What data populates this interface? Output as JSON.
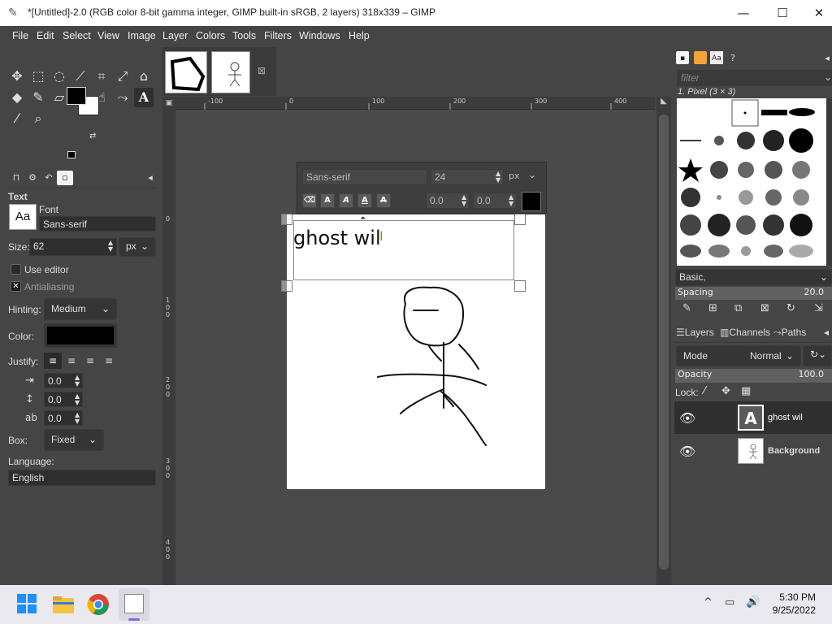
{
  "window": {
    "title": "*[Untitled]-2.0 (RGB color 8-bit gamma integer, GIMP built-in sRGB, 2 layers) 318x339 – GIMP",
    "minimize": "—",
    "maximize": "☐",
    "close": "✕"
  },
  "menu": [
    "File",
    "Edit",
    "Select",
    "View",
    "Image",
    "Layer",
    "Colors",
    "Tools",
    "Filters",
    "Windows",
    "Help"
  ],
  "toolbox": {
    "tools": [
      "move-icon",
      "rect-select-icon",
      "lasso-icon",
      "fuzzy-select-icon",
      "crop-icon",
      "transform-icon",
      "warp-icon",
      "bucket-fill-icon",
      "paintbrush-icon",
      "eraser-icon",
      "clone-icon",
      "smudge-icon",
      "paths-icon",
      "text-icon",
      "color-picker-icon",
      "zoom-icon"
    ]
  },
  "tool_options": {
    "section_title": "Text",
    "font_label": "Font",
    "font_preview": "Aa",
    "font_value": "Sans-serif",
    "size_label": "Size:",
    "size_value": "62",
    "size_unit": "px",
    "use_editor": "Use editor",
    "antialiasing": "Antialiasing",
    "hinting_label": "Hinting:",
    "hinting_value": "Medium",
    "color_label": "Color:",
    "justify_label": "Justify:",
    "indent_value": "0.0",
    "line_spacing_value": "0.0",
    "letter_spacing_value": "0.0",
    "box_label": "Box:",
    "box_value": "Fixed",
    "language_label": "Language:",
    "language_value": "English"
  },
  "rulers": {
    "h_ticks": [
      "-100",
      "0",
      "100",
      "200",
      "300",
      "400"
    ],
    "v_ticks": [
      "100",
      "200",
      "300",
      "400"
    ],
    "v_zero": "0"
  },
  "text_style_editor": {
    "font": "Sans-serif",
    "size": "24",
    "unit": "px",
    "baseline": "0.0",
    "kerning": "0.0"
  },
  "canvas_text": "ghost wil",
  "dock": {
    "filter_placeholder": "filter",
    "brush_name": "1. Pixel (3 × 3)",
    "brush_set": "Basic,",
    "spacing_label": "Spacing",
    "spacing_value": "20.0",
    "tabs": [
      "Layers",
      "Channels",
      "Paths"
    ],
    "mode_label": "Mode",
    "mode_value": "Normal",
    "opacity_label": "Opacity",
    "opacity_value": "100.0",
    "lock_label": "Lock:",
    "layers": [
      {
        "name": "ghost wil",
        "bold": false
      },
      {
        "name": "Background",
        "bold": true
      }
    ]
  },
  "taskbar": {
    "time": "5:30 PM",
    "date": "9/25/2022"
  }
}
